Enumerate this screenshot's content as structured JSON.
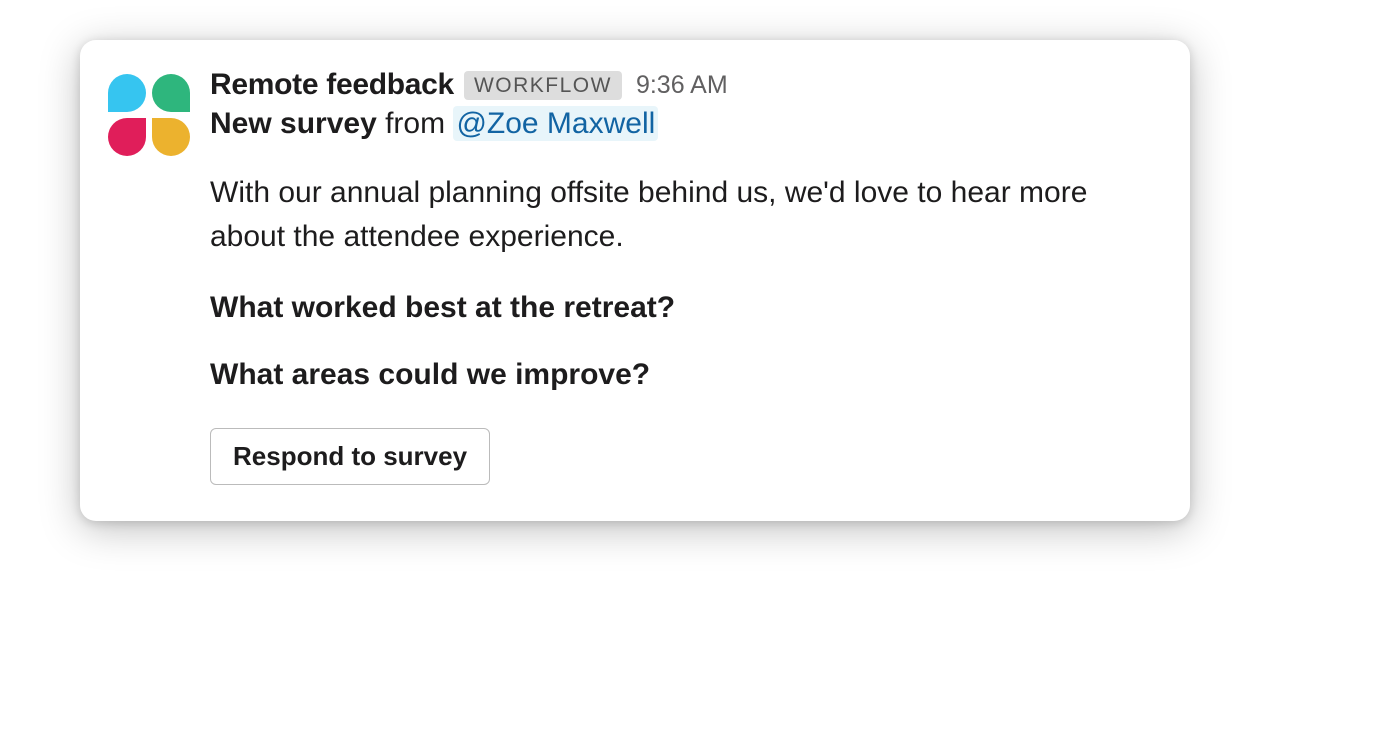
{
  "message": {
    "sender": "Remote feedback",
    "badge": "WORKFLOW",
    "timestamp": "9:36 AM",
    "survey_label": "New survey",
    "survey_from": " from ",
    "mention": "@Zoe Maxwell",
    "body": "With our annual planning offsite behind us, we'd love to hear more about the attendee experience.",
    "question1": "What worked best at the retreat?",
    "question2": "What areas could we improve?",
    "button_label": "Respond to survey"
  }
}
